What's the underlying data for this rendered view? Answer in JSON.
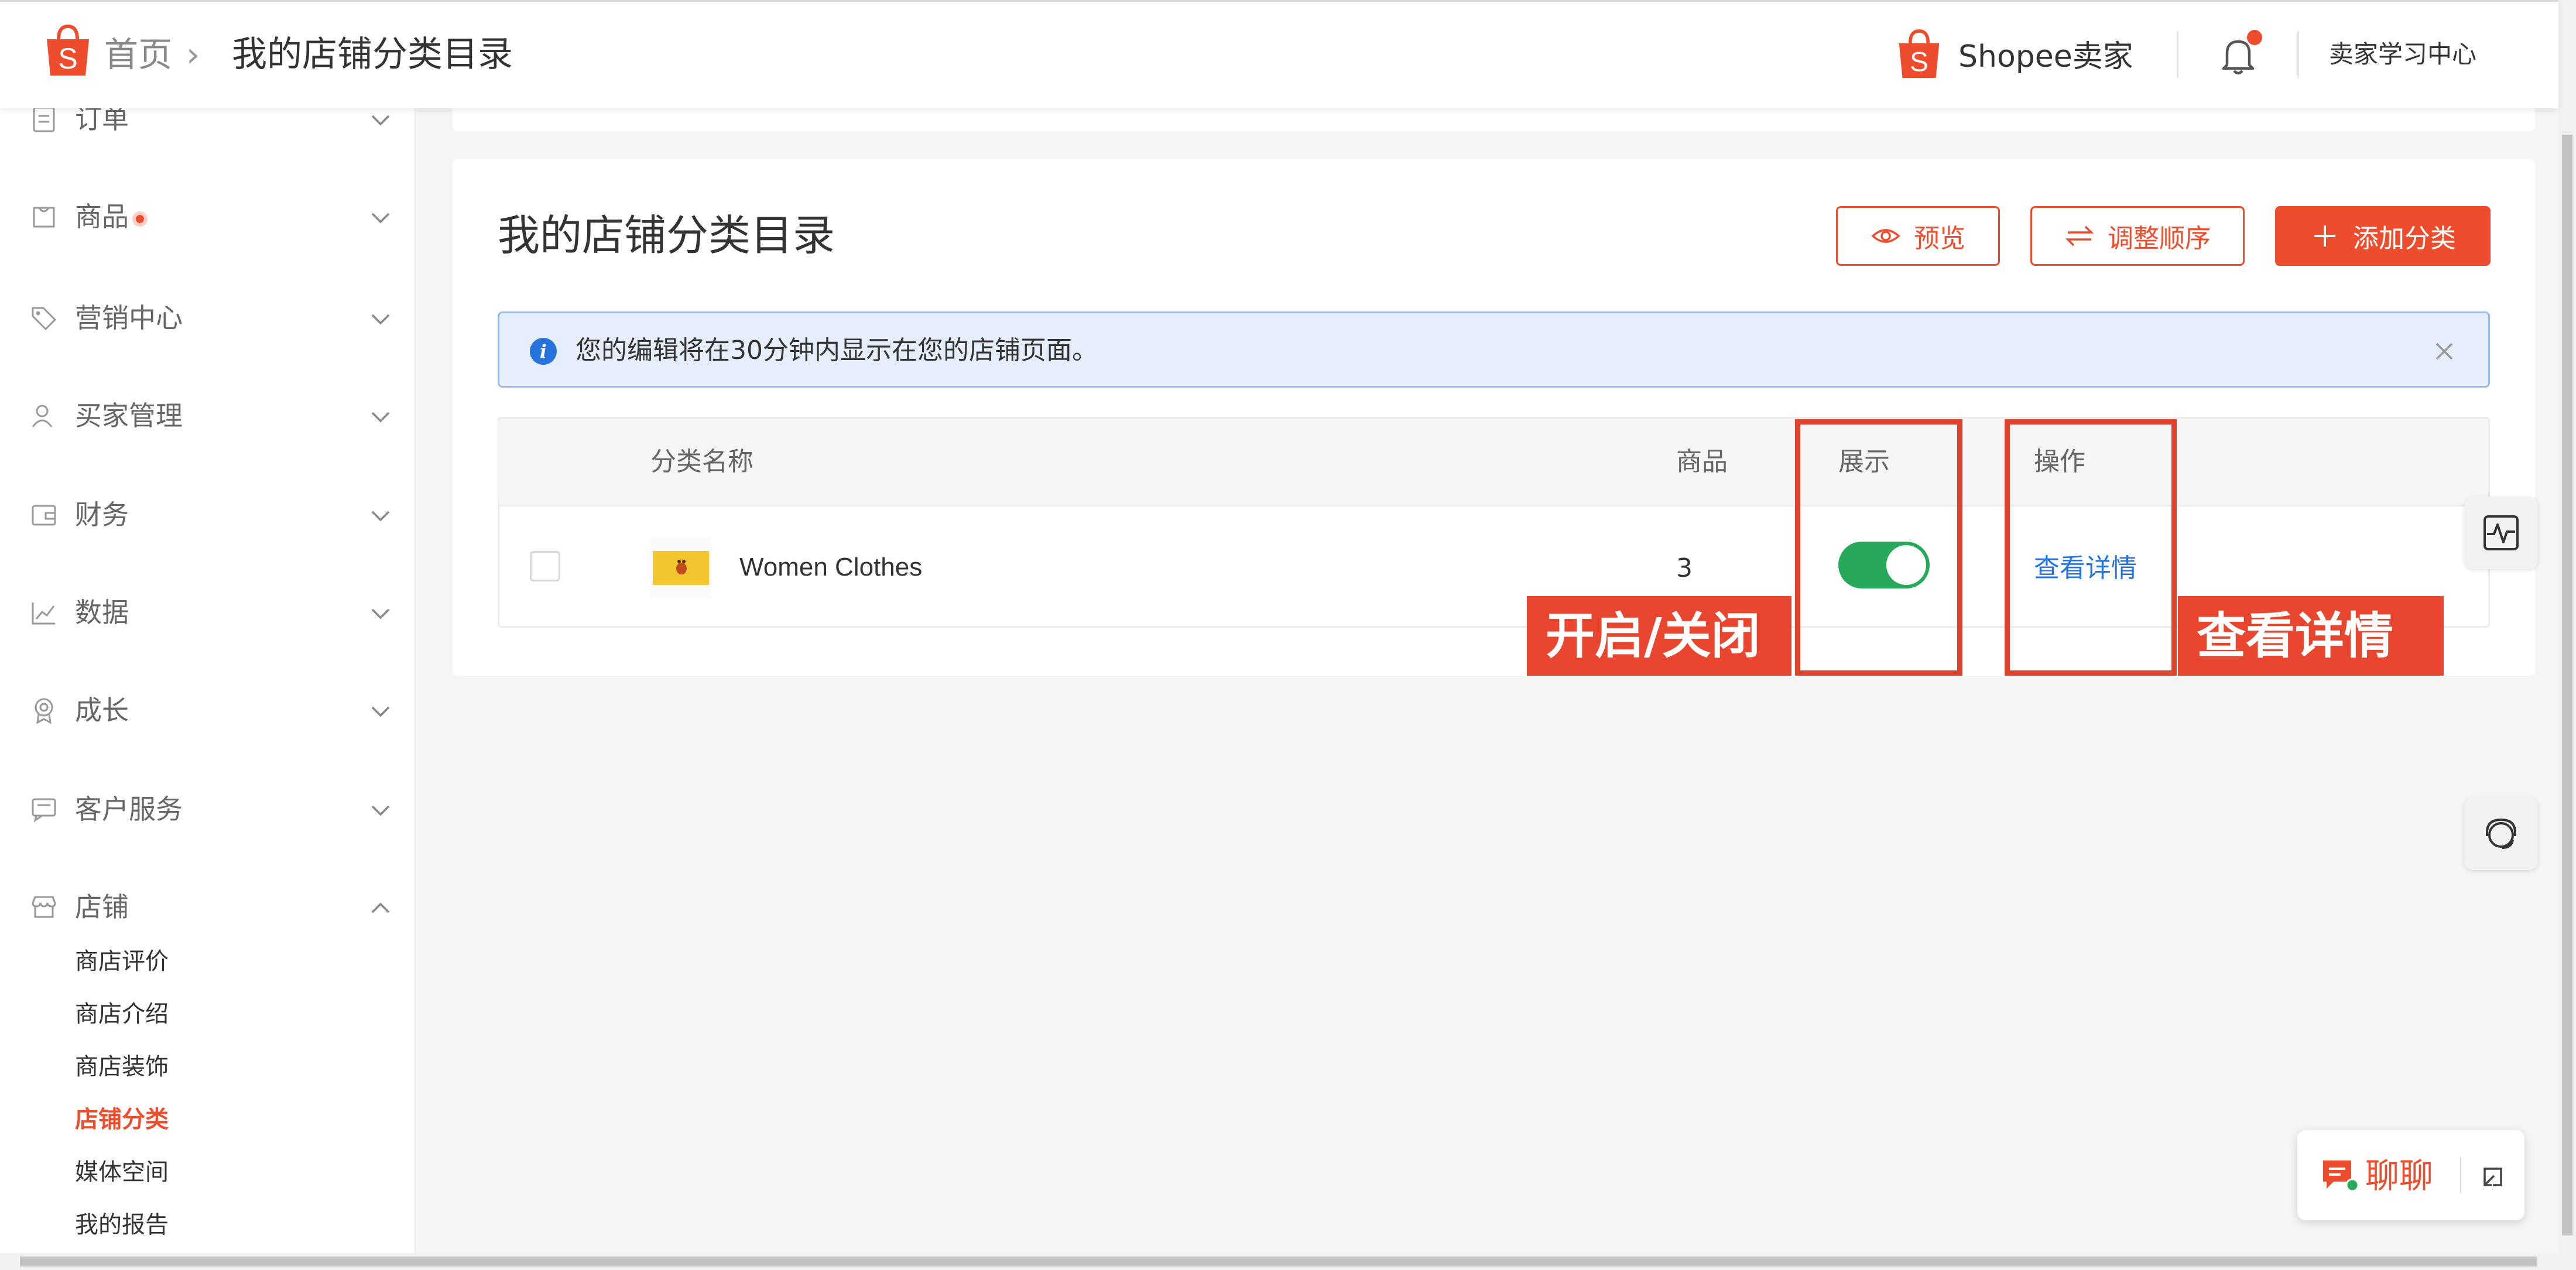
{
  "header": {
    "breadcrumb_home": "首页",
    "breadcrumb_separator": "›",
    "breadcrumb_current": "我的店铺分类目录",
    "seller_brand": "Shopee卖家",
    "learning_center": "卖家学习中心"
  },
  "sidebar": {
    "items": [
      {
        "label": "订单",
        "icon": "order-icon"
      },
      {
        "label": "商品",
        "icon": "product-icon",
        "has_dot": true
      },
      {
        "label": "营销中心",
        "icon": "tag-icon"
      },
      {
        "label": "买家管理",
        "icon": "user-icon"
      },
      {
        "label": "财务",
        "icon": "wallet-icon"
      },
      {
        "label": "数据",
        "icon": "chart-icon"
      },
      {
        "label": "成长",
        "icon": "medal-icon"
      },
      {
        "label": "客户服务",
        "icon": "service-icon"
      },
      {
        "label": "店铺",
        "icon": "shop-icon",
        "expanded": true
      }
    ],
    "shop_subitems": [
      {
        "label": "商店评价"
      },
      {
        "label": "商店介绍"
      },
      {
        "label": "商店装饰"
      },
      {
        "label": "店铺分类",
        "active": true
      },
      {
        "label": "媒体空间"
      },
      {
        "label": "我的报告"
      }
    ]
  },
  "main": {
    "title": "我的店铺分类目录",
    "buttons": {
      "preview": "预览",
      "reorder": "调整顺序",
      "add_category": "添加分类"
    },
    "alert_text": "您的编辑将在30分钟内显示在您的店铺页面。",
    "table": {
      "columns": {
        "name": "分类名称",
        "products": "商品",
        "display": "展示",
        "actions": "操作"
      },
      "rows": [
        {
          "name": "Women Clothes",
          "products": "3",
          "display_on": true,
          "action": "查看详情"
        }
      ]
    }
  },
  "annotations": {
    "toggle_label": "开启/关闭",
    "detail_label": "查看详情"
  },
  "chat": {
    "label": "聊聊"
  },
  "colors": {
    "brand": "#ee4d2d",
    "toggle_on": "#26aa5a",
    "link": "#2673dd",
    "alert_bg": "#e5eefa"
  }
}
